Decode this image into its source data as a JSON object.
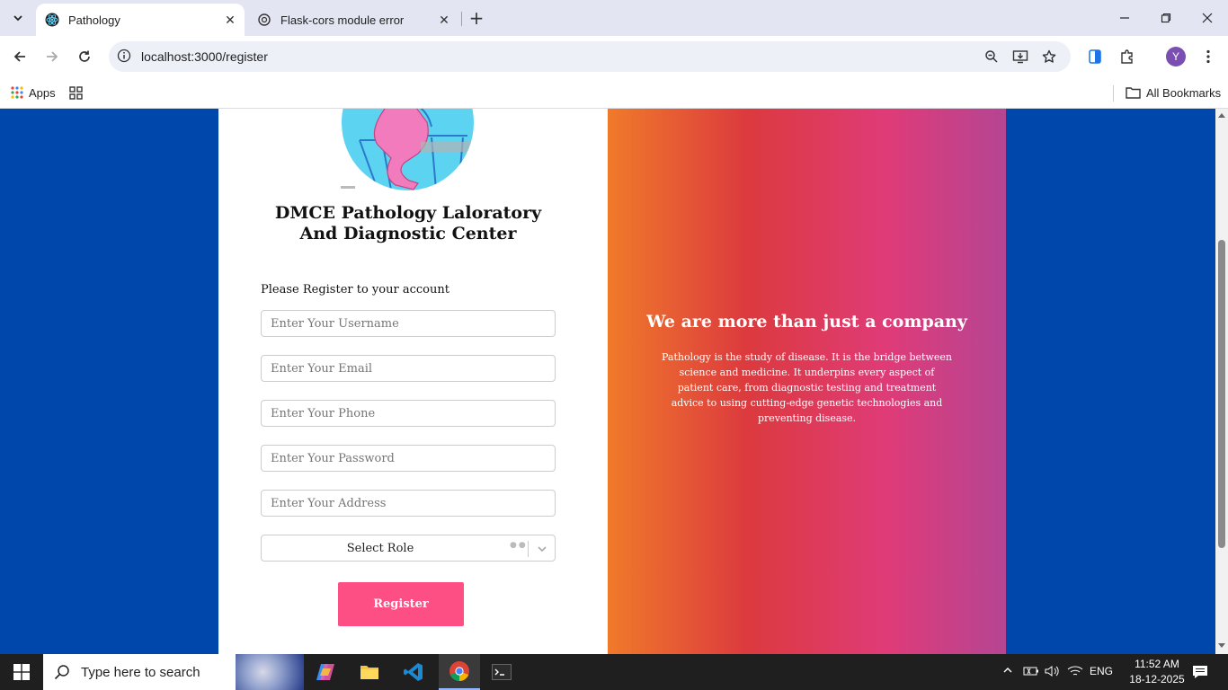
{
  "browser": {
    "tabs": [
      {
        "title": "Pathology",
        "active": true
      },
      {
        "title": "Flask-cors module error",
        "active": false
      }
    ],
    "url": "localhost:3000/register",
    "profile_initial": "Y",
    "bookmarks": {
      "apps_label": "Apps",
      "all_bookmarks_label": "All Bookmarks"
    }
  },
  "page": {
    "brand_title": "DMCE Pathology Laloratory And Diagnostic Center",
    "form_subtitle": "Please Register to your account",
    "fields": {
      "username_placeholder": "Enter Your Username",
      "email_placeholder": "Enter Your Email",
      "phone_placeholder": "Enter Your Phone",
      "password_placeholder": "Enter Your Password",
      "address_placeholder": "Enter Your Address"
    },
    "role_select": {
      "selected": "Select Role"
    },
    "register_label": "Register",
    "promo": {
      "heading": "We are more than just a company",
      "body": "Pathology is the study of disease. It is the bridge between science and medicine. It underpins every aspect of patient care, from diagnostic testing and treatment advice to using cutting-edge genetic technologies and preventing disease."
    }
  },
  "taskbar": {
    "search_placeholder": "Type here to search",
    "language": "ENG",
    "time": "11:52 AM",
    "date": "18-12-2025"
  },
  "colors": {
    "page_background": "#0047ab",
    "register_button": "#fe4f85",
    "gradient_start": "#f07a2a",
    "gradient_end": "#b54593"
  }
}
